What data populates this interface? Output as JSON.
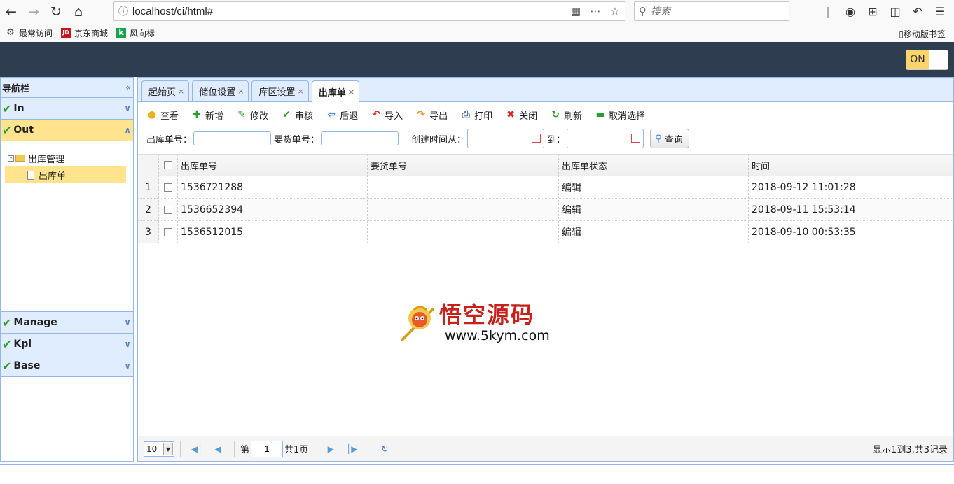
{
  "browser": {
    "url": "localhost/ci/html#",
    "search_placeholder": "搜索",
    "bookmarks": [
      "最常访问",
      "京东商城",
      "风向标"
    ],
    "mobile_bookmarks": "移动版书签"
  },
  "header": {
    "toggle_label": "ON"
  },
  "sidebar": {
    "title": "导航栏",
    "sections": [
      {
        "label": "In"
      },
      {
        "label": "Out"
      },
      {
        "label": "Manage"
      },
      {
        "label": "Kpi"
      },
      {
        "label": "Base"
      }
    ],
    "tree": {
      "folder": "出库管理",
      "leaf": "出库单"
    }
  },
  "tabs": [
    "起始页",
    "储位设置",
    "库区设置",
    "出库单"
  ],
  "toolbar": [
    "查看",
    "新增",
    "修改",
    "审核",
    "后退",
    "导入",
    "导出",
    "打印",
    "关闭",
    "刷新",
    "取消选择"
  ],
  "search": {
    "out_no_label": "出库单号：",
    "req_no_label": "要货单号：",
    "created_from_label": "创建时间从：",
    "to_label": "到：",
    "query_button": "查询"
  },
  "grid": {
    "columns": [
      "出库单号",
      "要货单号",
      "出库单状态",
      "时间"
    ],
    "rows": [
      {
        "num": "1",
        "out_no": "1536721288",
        "req_no": "",
        "status": "编辑",
        "time": "2018-09-12 11:01:28"
      },
      {
        "num": "2",
        "out_no": "1536652394",
        "req_no": "",
        "status": "编辑",
        "time": "2018-09-11 15:53:14"
      },
      {
        "num": "3",
        "out_no": "1536512015",
        "req_no": "",
        "status": "编辑",
        "time": "2018-09-10 00:53:35"
      }
    ]
  },
  "watermark": {
    "title": "悟空源码",
    "url": "www.5kym.com"
  },
  "pager": {
    "page_size": "10",
    "page_prefix": "第",
    "page_value": "1",
    "page_total": "共1页",
    "info": "显示1到3,共3记录"
  }
}
